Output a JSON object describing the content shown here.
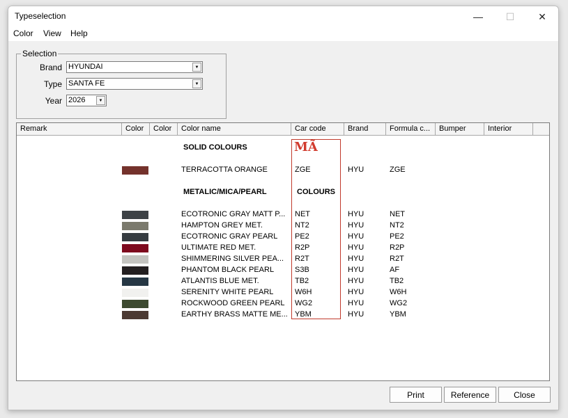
{
  "window": {
    "title": "Typeselection",
    "minimize": "—",
    "maximize": "☐",
    "close": "✕"
  },
  "menu": [
    "Color",
    "View",
    "Help"
  ],
  "selection": {
    "legend": "Selection",
    "brand_label": "Brand",
    "brand_value": "HYUNDAI",
    "type_label": "Type",
    "type_value": "SANTA FE",
    "year_label": "Year",
    "year_value": "2026"
  },
  "columns": [
    "Remark",
    "Color",
    "Color",
    "Color name",
    "Car code",
    "Brand",
    "Formula c...",
    "Bumper",
    "Interior"
  ],
  "sections": {
    "solid": "SOLID COLOURS",
    "metallic": "METALIC/MICA/PEARL",
    "metallic_suffix": "COLOURS"
  },
  "logo_text": "MÃ",
  "rows_solid": [
    {
      "name": "TERRACOTTA ORANGE",
      "code": "ZGE",
      "brand": "HYU",
      "formula": "ZGE",
      "color": "#74322c"
    }
  ],
  "rows_metallic": [
    {
      "name": "ECOTRONIC GRAY MATT P...",
      "code": "NET",
      "brand": "HYU",
      "formula": "NET",
      "color": "#3d4246"
    },
    {
      "name": "HAMPTON GREY MET.",
      "code": "NT2",
      "brand": "HYU",
      "formula": "NT2",
      "color": "#7b7a6d"
    },
    {
      "name": "ECOTRONIC GRAY PEARL",
      "code": "PE2",
      "brand": "HYU",
      "formula": "PE2",
      "color": "#363c41"
    },
    {
      "name": "ULTIMATE RED MET.",
      "code": "R2P",
      "brand": "HYU",
      "formula": "R2P",
      "color": "#7e0a1e"
    },
    {
      "name": "SHIMMERING SILVER PEA...",
      "code": "R2T",
      "brand": "HYU",
      "formula": "R2T",
      "color": "#c4c4c0"
    },
    {
      "name": "PHANTOM BLACK PEARL",
      "code": "S3B",
      "brand": "HYU",
      "formula": "AF",
      "color": "#231f20"
    },
    {
      "name": "ATLANTIS BLUE MET.",
      "code": "TB2",
      "brand": "HYU",
      "formula": "TB2",
      "color": "#263744"
    },
    {
      "name": "SERENITY WHITE PEARL",
      "code": "W6H",
      "brand": "HYU",
      "formula": "W6H",
      "color": "#f1f1ef"
    },
    {
      "name": "ROCKWOOD GREEN PEARL",
      "code": "WG2",
      "brand": "HYU",
      "formula": "WG2",
      "color": "#3d4a30"
    },
    {
      "name": "EARTHY BRASS MATTE ME...",
      "code": "YBM",
      "brand": "HYU",
      "formula": "YBM",
      "color": "#4c3a33"
    }
  ],
  "buttons": {
    "print": "Print",
    "reference": "Reference",
    "close": "Close"
  }
}
